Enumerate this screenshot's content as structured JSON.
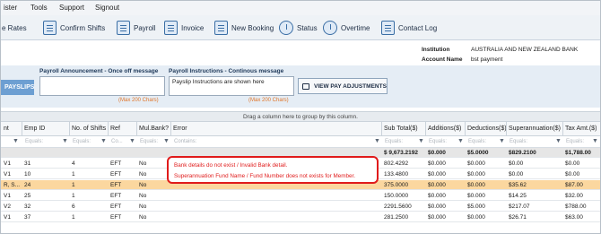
{
  "menu": {
    "items": [
      "ister",
      "Tools",
      "Support",
      "Signout"
    ]
  },
  "toolbar": {
    "rates": "e Rates",
    "confirm_shifts": "Confirm Shifts",
    "payroll": "Payroll",
    "invoice": "Invoice",
    "new_booking": "New Booking",
    "status": "Status",
    "overtime": "Overtime",
    "contact_log": "Contact Log"
  },
  "info": {
    "institution_label": "Institution",
    "institution_value": "AUSTRALIA AND NEW ZEALAND BANK",
    "account_label": "Account Name",
    "account_value": "bst payment"
  },
  "panel": {
    "payslips_label": "PAYSLIPS",
    "announcement_title": "Payroll Announcement - Once off message",
    "announcement_text": "",
    "announcement_max": "(Max 200 Chars)",
    "instructions_title": "Payroll Instructions - Continous message",
    "instructions_text": "Payslip Instructions are shown here",
    "instructions_max": "(Max 200 Chars)",
    "view_pay_adjustments": "VIEW PAY ADJUSTMENTS"
  },
  "grid": {
    "drag_hint": "Drag a column here to group by this column.",
    "headers": {
      "nt": "nt",
      "emp_id": "Emp ID",
      "shifts": "No. of Shifts",
      "ref": "Ref",
      "mulbank": "Mul.Bank?",
      "error": "Error",
      "subtotal": "Sub Total($)",
      "additions": "Additions($)",
      "deductions": "Deductions($)",
      "super": "Superannuation($)",
      "tax": "Tax Amt.($)"
    },
    "filters": {
      "emp_id": "Equals:",
      "shifts": "Equals:",
      "ref": "Co...",
      "mulbank": "Equals:",
      "error": "Contains:",
      "subtotal": "Equals:",
      "additions": "Equals:",
      "deductions": "Equals:",
      "super": "Equals:",
      "tax": "Equals:"
    },
    "totals": {
      "subtotal": "$ 9,673.2192",
      "additions": "$0.000",
      "deductions": "$5.0000",
      "super": "$829.2100",
      "tax": "$1,788.00"
    },
    "rows": [
      {
        "nt": "V1",
        "emp_id": "31",
        "shifts": "4",
        "ref": "EFT",
        "mulbank": "No",
        "subtotal": "802.4292",
        "additions": "$0.000",
        "deductions": "$0.000",
        "super": "$0.00",
        "tax": "$0.00"
      },
      {
        "nt": "V1",
        "emp_id": "10",
        "shifts": "1",
        "ref": "EFT",
        "mulbank": "No",
        "subtotal": "133.4800",
        "additions": "$0.000",
        "deductions": "$0.000",
        "super": "$0.00",
        "tax": "$0.00"
      },
      {
        "nt": "R, S...",
        "emp_id": "24",
        "shifts": "1",
        "ref": "EFT",
        "mulbank": "No",
        "subtotal": "375.0000",
        "additions": "$0.000",
        "deductions": "$0.000",
        "super": "$35.62",
        "tax": "$87.00"
      },
      {
        "nt": "V1",
        "emp_id": "25",
        "shifts": "1",
        "ref": "EFT",
        "mulbank": "No",
        "subtotal": "150.0000",
        "additions": "$0.000",
        "deductions": "$0.000",
        "super": "$14.25",
        "tax": "$32.00"
      },
      {
        "nt": "V2",
        "emp_id": "32",
        "shifts": "6",
        "ref": "EFT",
        "mulbank": "No",
        "subtotal": "2291.5600",
        "additions": "$0.000",
        "deductions": "$5.000",
        "super": "$217.07",
        "tax": "$788.00"
      },
      {
        "nt": "V1",
        "emp_id": "37",
        "shifts": "1",
        "ref": "EFT",
        "mulbank": "No",
        "subtotal": "281.2500",
        "additions": "$0.000",
        "deductions": "$0.000",
        "super": "$26.71",
        "tax": "$63.00"
      }
    ],
    "errors": [
      "Bank details do not exist / Invalid Bank detail.",
      "Superannuation Fund Name / Fund Number does not exists for Member."
    ]
  }
}
